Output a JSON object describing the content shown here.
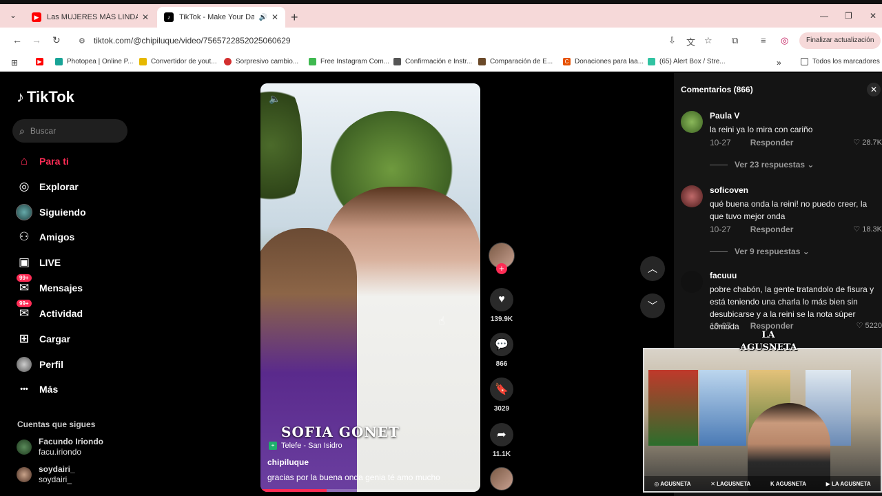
{
  "browser": {
    "tabs": [
      {
        "title": "Las MUJERES MÁS LINDAS de A",
        "favicon": "youtube-icon",
        "color": "#ff0000"
      },
      {
        "title": "TikTok - Make Your Day",
        "favicon": "tiktok-icon",
        "color": "#000000"
      }
    ],
    "url": "tiktok.com/@chipiluque/video/7565722852025060629",
    "update_button": "Finalizar actualización",
    "bookmarks": [
      {
        "label": "",
        "icon": "youtube-icon",
        "color": "#ff0000"
      },
      {
        "label": "Photopea | Online P...",
        "icon": "photopea-icon",
        "color": "#18a497"
      },
      {
        "label": "Convertidor de yout...",
        "icon": "folder-icon",
        "color": "#e6b800"
      },
      {
        "label": "Sorpresivo cambio...",
        "icon": "news-icon",
        "color": "#d32f2f"
      },
      {
        "label": "Free Instagram Com...",
        "icon": "check-icon",
        "color": "#3fb950"
      },
      {
        "label": "Confirmación e Instr...",
        "icon": "link-icon",
        "color": "#555555"
      },
      {
        "label": "Comparación de E...",
        "icon": "book-icon",
        "color": "#6b4a2a"
      },
      {
        "label": "Donaciones para laa...",
        "icon": "c-icon",
        "color": "#e65100"
      },
      {
        "label": "(65) Alert Box / Stre...",
        "icon": "streamlabs-icon",
        "color": "#31c3a2"
      }
    ],
    "all_bookmarks": "Todos los marcadores"
  },
  "sidebar": {
    "logo": "TikTok",
    "search_placeholder": "Buscar",
    "items": [
      {
        "label": "Para ti",
        "icon": "home-icon",
        "glyph": "⌂"
      },
      {
        "label": "Explorar",
        "icon": "compass-icon",
        "glyph": "◎"
      },
      {
        "label": "Siguiendo",
        "icon": "following-avatar-icon",
        "glyph": "◉"
      },
      {
        "label": "Amigos",
        "icon": "friends-icon",
        "glyph": "👥"
      },
      {
        "label": "LIVE",
        "icon": "live-tv-icon",
        "glyph": "📺"
      },
      {
        "label": "Mensajes",
        "icon": "messages-icon",
        "glyph": "✉",
        "badge": "99+"
      },
      {
        "label": "Actividad",
        "icon": "activity-icon",
        "glyph": "✉",
        "badge": "99+"
      },
      {
        "label": "Cargar",
        "icon": "upload-icon",
        "glyph": "⊞"
      },
      {
        "label": "Perfil",
        "icon": "profile-avatar-icon",
        "glyph": "◉"
      },
      {
        "label": "Más",
        "icon": "more-icon",
        "glyph": "•••"
      }
    ],
    "following_title": "Cuentas que sigues",
    "following": [
      {
        "name": "Facundo Iriondo",
        "handle": "facu.iriondo"
      },
      {
        "name": "soydairi_",
        "handle": "soydairi_"
      }
    ]
  },
  "video": {
    "overlay_name": "SOFIA GONET",
    "location": "Telefe - San Isidro",
    "author": "chipiluque",
    "caption": "gracias por la buena onda genia té amo mucho",
    "progress": 0.3
  },
  "actions": {
    "likes": "139.9K",
    "comments": "866",
    "saves": "3029",
    "shares": "11.1K"
  },
  "comments": {
    "header": "Comentarios (866)",
    "items": [
      {
        "user": "Paula V",
        "text": "la reini ya lo mira con cariño",
        "date": "10-27",
        "reply": "Responder",
        "likes": "28.7K",
        "more": "Ver 23 respuestas",
        "avatar_color": "#5b8a3a"
      },
      {
        "user": "soficoven",
        "text": "qué buena onda la reini! no puedo creer, la que tuvo mejor onda",
        "date": "10-27",
        "reply": "Responder",
        "likes": "18.3K",
        "more": "Ver 9 respuestas",
        "avatar_color": "#7a3a3a"
      },
      {
        "user": "facuuu",
        "text": "pobre chabón, la gente tratandolo de fisura y está teniendo una charla lo más bien sin desubicarse y a la reini se la nota súper cómoda",
        "date": "10-27",
        "reply": "Responder",
        "likes": "5220",
        "avatar_color": "#111111"
      }
    ]
  },
  "stream": {
    "logo_line1": "LA",
    "logo_line2": "AGUSNETA",
    "socials": [
      "AGUSNETA",
      "LAGUSNETA",
      "AGUSNETA",
      "LA AGUSNETA"
    ]
  },
  "colors": {
    "accent": "#fe2c55",
    "background": "#000000",
    "panel": "#141414"
  }
}
